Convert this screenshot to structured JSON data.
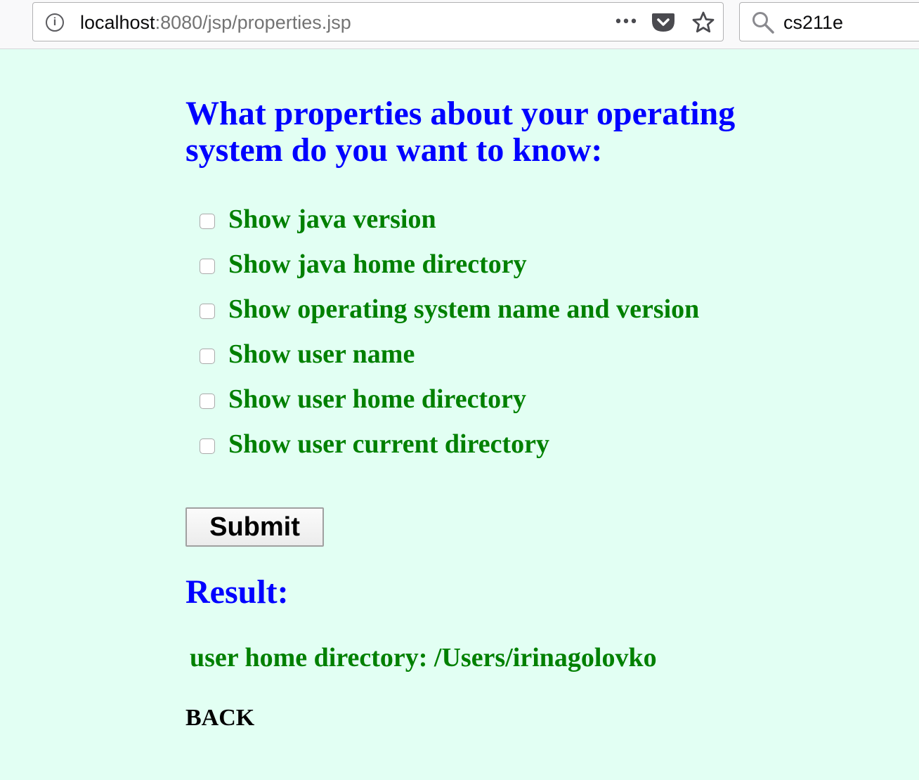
{
  "browser": {
    "url_host": "localhost",
    "url_path": ":8080/jsp/properties.jsp",
    "search_value": "cs211e",
    "icons": {
      "info": "info-icon",
      "page_actions": "more-icon",
      "pocket": "pocket-icon",
      "bookmark": "star-icon",
      "search": "search-icon"
    }
  },
  "page": {
    "heading": "What properties about your operating system do you want to know:",
    "options": [
      {
        "label": "Show java version",
        "checked": false
      },
      {
        "label": "Show java home directory",
        "checked": false
      },
      {
        "label": "Show operating system name and version",
        "checked": false
      },
      {
        "label": "Show user name",
        "checked": false
      },
      {
        "label": "Show user home directory",
        "checked": false
      },
      {
        "label": "Show user current directory",
        "checked": false
      }
    ],
    "submit_label": "Submit",
    "result_heading": "Result:",
    "result_text": "user home directory: /Users/irinagolovko",
    "back_label": "BACK"
  },
  "colors": {
    "page_background": "#e2fff3",
    "heading": "#0000ff",
    "option_text": "#008000",
    "back_link": "#000000"
  }
}
